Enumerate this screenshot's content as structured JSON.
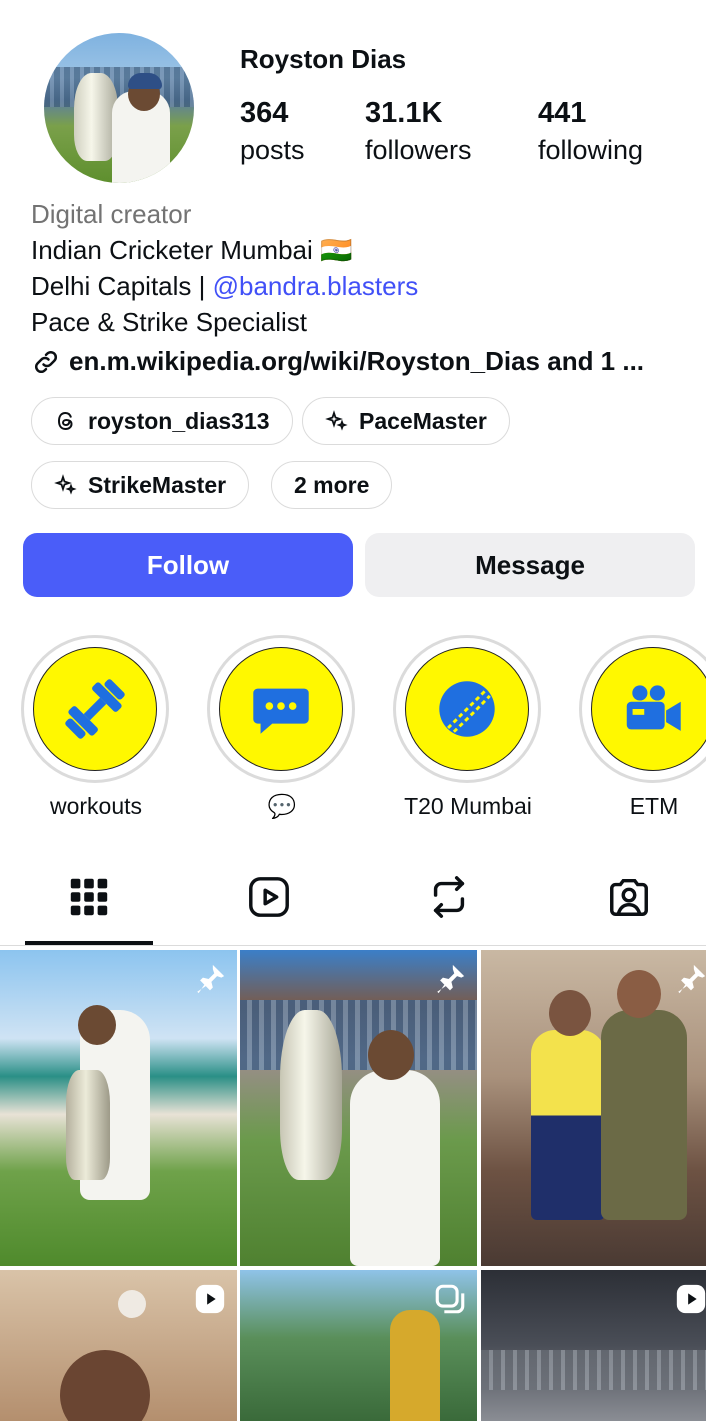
{
  "profile": {
    "name": "Royston Dias",
    "stats": [
      {
        "value": "364",
        "label": "posts"
      },
      {
        "value": "31.1K",
        "label": "followers"
      },
      {
        "value": "441",
        "label": "following"
      }
    ],
    "category": "Digital creator",
    "bio_line1": "Indian Cricketer Mumbai 🇮🇳",
    "bio_line2_prefix": "Delhi Capitals | ",
    "bio_line2_mention": "@bandra.blasters",
    "bio_line3": "Pace & Strike Specialist",
    "link": "en.m.wikipedia.org/wiki/Royston_Dias and 1 ..."
  },
  "chips": [
    {
      "label": "royston_dias313",
      "icon": "threads-icon"
    },
    {
      "label": "PaceMaster",
      "icon": "sparkle-icon"
    },
    {
      "label": "StrikeMaster",
      "icon": "sparkle-icon"
    },
    {
      "label": "2 more"
    }
  ],
  "actions": {
    "follow": "Follow",
    "message": "Message"
  },
  "highlights": [
    {
      "label": "workouts",
      "icon": "dumbbell-icon"
    },
    {
      "label": "💬",
      "icon": "chat-bubble-icon"
    },
    {
      "label": "T20 Mumbai",
      "icon": "cricket-ball-icon"
    },
    {
      "label": "ETM",
      "icon": "video-camera-icon"
    }
  ],
  "tabs": [
    "grid-icon",
    "reels-icon",
    "reposts-icon",
    "tagged-icon"
  ],
  "colors": {
    "accent": "#4a5df9",
    "highlight": "#fff800",
    "mention": "#4150f7"
  }
}
